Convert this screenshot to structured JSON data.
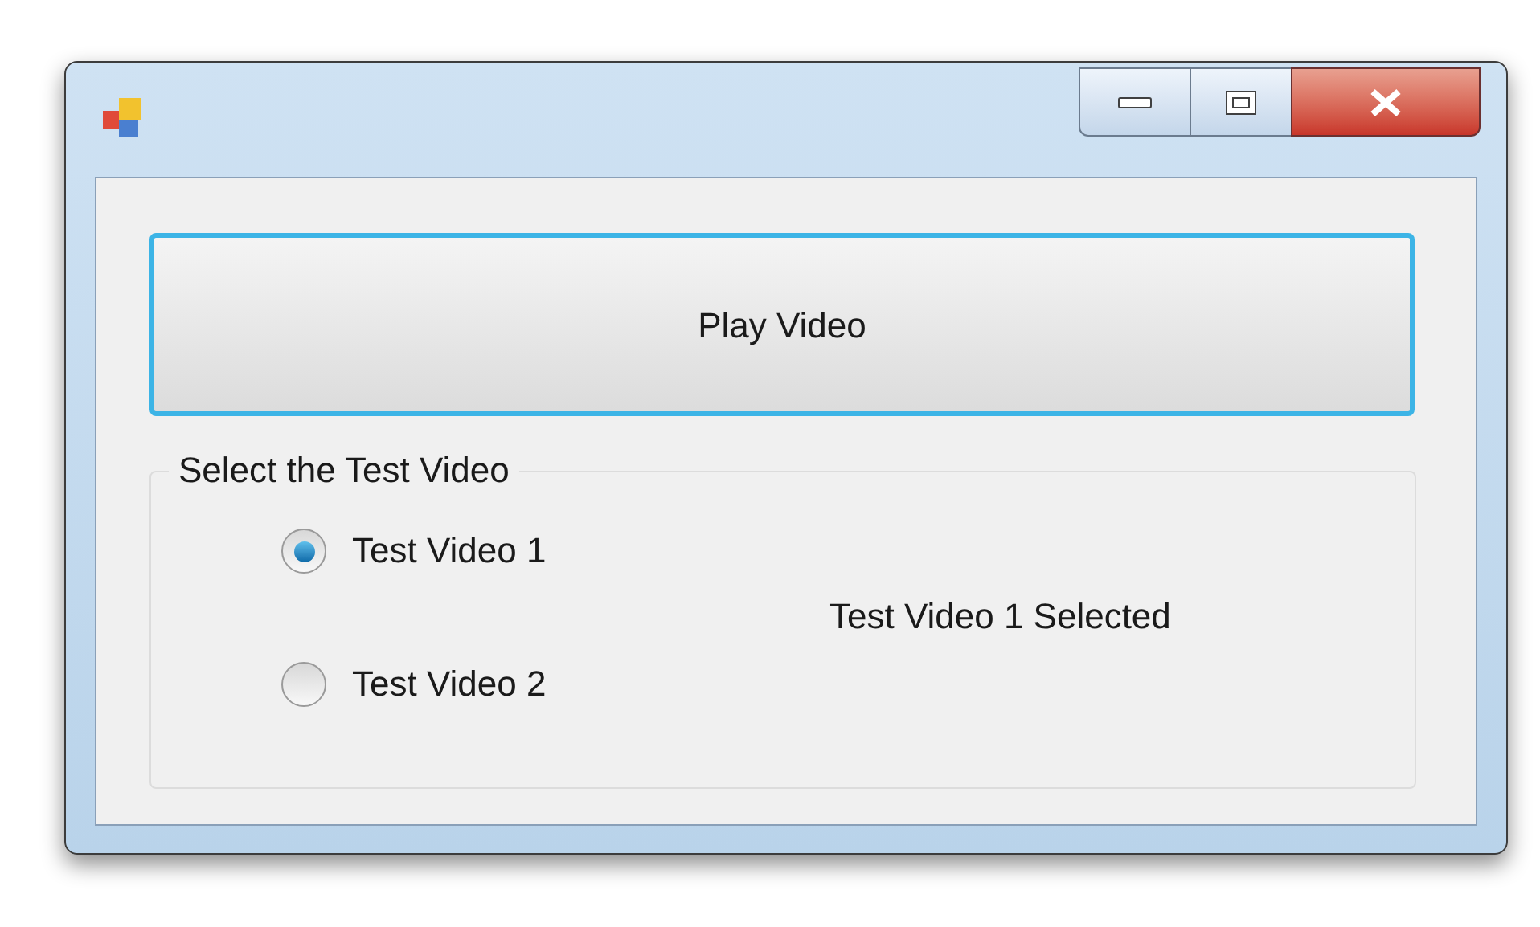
{
  "play_button": {
    "label": "Play Video",
    "focused": true
  },
  "group": {
    "title": "Select the Test Video",
    "options": [
      {
        "label": "Test Video 1",
        "selected": true
      },
      {
        "label": "Test Video 2",
        "selected": false
      }
    ],
    "status": "Test Video 1 Selected"
  }
}
